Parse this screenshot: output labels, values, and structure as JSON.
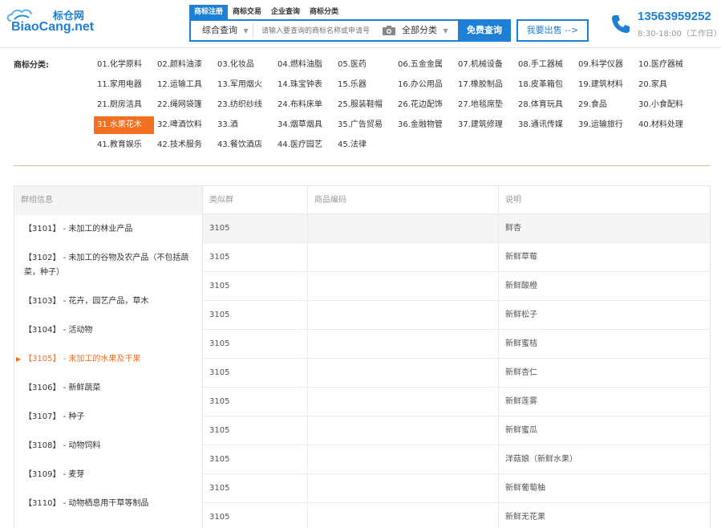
{
  "header": {
    "logo_cn": "标仓网",
    "logo_en": "BiaoCang.net",
    "tabs": [
      {
        "label": "商标注册",
        "active": true
      },
      {
        "label": "商标交易",
        "active": false
      },
      {
        "label": "企业查询",
        "active": false
      },
      {
        "label": "商标分类",
        "active": false
      }
    ],
    "search": {
      "type_label": "综合查询",
      "placeholder": "请输入要查询的商标名称或申请号",
      "category_label": "全部分类",
      "button_label": "免费查询"
    },
    "post_button": "我要出售 -->",
    "phone": "13563959252",
    "hours": "8:30-18:00（工作日）",
    "accent": "#1e7fd6"
  },
  "categories": {
    "label": "商标分类:",
    "active_color": "#f36f21",
    "items": [
      "01.化学原料",
      "02.颜料油漆",
      "03.化妆品",
      "04.燃料油脂",
      "05.医药",
      "06.五金金属",
      "07.机械设备",
      "08.手工器械",
      "09.科学仪器",
      "10.医疗器械",
      "11.家用电器",
      "12.运输工具",
      "13.军用烟火",
      "14.珠宝钟表",
      "15.乐器",
      "16.办公用品",
      "17.橡胶制品",
      "18.皮革箱包",
      "19.建筑材料",
      "20.家具",
      "21.厨房洁具",
      "22.绳网袋篷",
      "23.纺织纱线",
      "24.布料床单",
      "25.服装鞋帽",
      "26.花边配饰",
      "27.地毯席垫",
      "28.体育玩具",
      "29.食品",
      "30.小食配料",
      "31.水果花木",
      "32.啤酒饮料",
      "33.酒",
      "34.烟草烟具",
      "35.广告贸易",
      "36.金融物管",
      "37.建筑修理",
      "38.通讯传媒",
      "39.运输旅行",
      "40.材料处理",
      "41.教育娱乐",
      "42.技术服务",
      "43.餐饮酒店",
      "44.医疗园艺",
      "45.法律"
    ],
    "active_index": 30
  },
  "groups": {
    "header": "群组信息",
    "items": [
      {
        "text": "【3101】 - 未加工的林业产品",
        "active": false
      },
      {
        "text": "【3102】 - 未加工的谷物及农产品（不包括蔬菜，种子）",
        "active": false
      },
      {
        "text": "【3103】 - 花卉，园艺产品，草木",
        "active": false
      },
      {
        "text": "【3104】 - 活动物",
        "active": false
      },
      {
        "text": "【3105】 - 未加工的水果及干果",
        "active": true
      },
      {
        "text": "【3106】 - 新鲜蔬菜",
        "active": false
      },
      {
        "text": "【3107】 - 种子",
        "active": false
      },
      {
        "text": "【3108】 - 动物饲料",
        "active": false
      },
      {
        "text": "【3109】 - 麦芽",
        "active": false
      },
      {
        "text": "【3110】 - 动物栖息用干草等制品",
        "active": false
      }
    ]
  },
  "table": {
    "columns": [
      "类似群",
      "商品编码",
      "说明"
    ],
    "rows": [
      [
        "3105",
        "",
        "鲜杏"
      ],
      [
        "3105",
        "",
        "新鲜草莓"
      ],
      [
        "3105",
        "",
        "新鲜酸橙"
      ],
      [
        "3105",
        "",
        "新鲜松子"
      ],
      [
        "3105",
        "",
        "新鲜蜜桔"
      ],
      [
        "3105",
        "",
        "新鲜杏仁"
      ],
      [
        "3105",
        "",
        "新鲜莲雾"
      ],
      [
        "3105",
        "",
        "新鲜蜜瓜"
      ],
      [
        "3105",
        "",
        "洋菇娘（新鲜水果）"
      ],
      [
        "3105",
        "",
        "新鲜葡萄柚"
      ],
      [
        "3105",
        "",
        "新鲜无花果"
      ]
    ]
  }
}
